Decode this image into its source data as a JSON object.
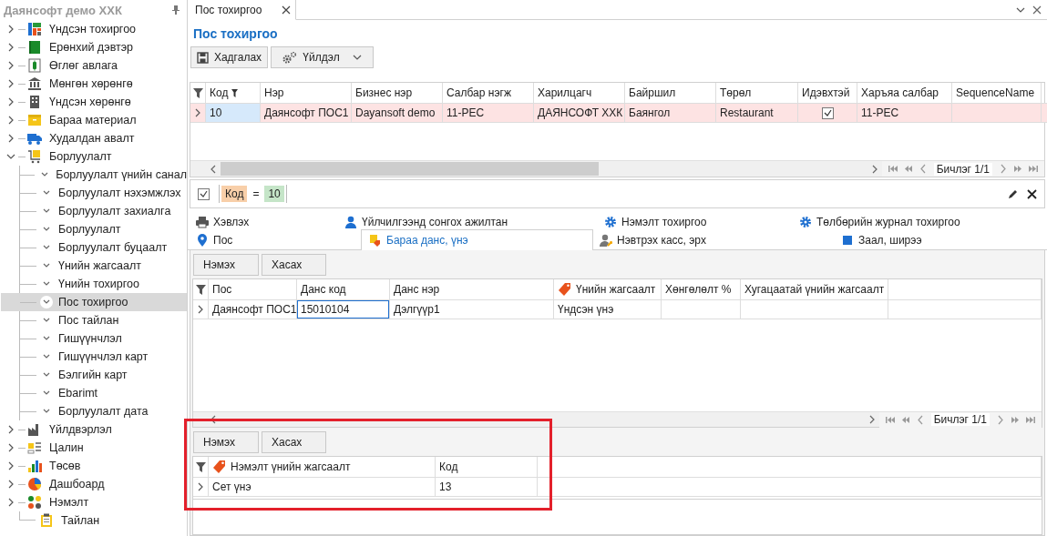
{
  "sidebar": {
    "title": "Даянсофт демо ХХК",
    "items": [
      {
        "label": "Үндсэн тохиргоо",
        "expanded": false
      },
      {
        "label": "Ерөнхий дэвтэр",
        "expanded": false
      },
      {
        "label": "Өглөг авлага",
        "expanded": false
      },
      {
        "label": "Мөнгөн хөрөнгө",
        "expanded": false
      },
      {
        "label": "Үндсэн хөрөнгө",
        "expanded": false
      },
      {
        "label": "Бараа материал",
        "expanded": false
      },
      {
        "label": "Худалдан авалт",
        "expanded": false
      },
      {
        "label": "Борлуулалт",
        "expanded": true,
        "children": [
          {
            "label": "Борлуулалт үнийн санал",
            "selected": false
          },
          {
            "label": "Борлуулалт нэхэмжлэх",
            "selected": false
          },
          {
            "label": "Борлуулалт захиалга",
            "selected": false
          },
          {
            "label": "Борлуулалт",
            "selected": false
          },
          {
            "label": "Борлуулалт буцаалт",
            "selected": false
          },
          {
            "label": "Үнийн жагсаалт",
            "selected": false
          },
          {
            "label": "Үнийн тохиргоо",
            "selected": false
          },
          {
            "label": "Пос тохиргоо",
            "selected": true
          },
          {
            "label": "Пос тайлан",
            "selected": false
          },
          {
            "label": "Гишүүнчлэл",
            "selected": false
          },
          {
            "label": "Гишүүнчлэл карт",
            "selected": false
          },
          {
            "label": "Бэлгийн карт",
            "selected": false
          },
          {
            "label": "Ebarimt",
            "selected": false
          },
          {
            "label": "Борлуулалт дата",
            "selected": false
          }
        ]
      },
      {
        "label": "Үйлдвэрлэл",
        "expanded": false
      },
      {
        "label": "Цалин",
        "expanded": false
      },
      {
        "label": "Төсөв",
        "expanded": false
      },
      {
        "label": "Дашбоард",
        "expanded": false
      },
      {
        "label": "Нэмэлт",
        "expanded": false
      },
      {
        "label": "Тайлан"
      }
    ]
  },
  "document_tab": {
    "label": "Пос тохиргоо"
  },
  "page_title": "Пос тохиргоо",
  "toolbar": [
    {
      "label": "Хадгалах",
      "kind": "save"
    },
    {
      "label": "Үйлдэл",
      "kind": "menu"
    }
  ],
  "main_grid": {
    "columns": [
      {
        "label": "Код",
        "filtered": true
      },
      {
        "label": "Нэр",
        "filtered": false
      },
      {
        "label": "Бизнес нэр",
        "filtered": false
      },
      {
        "label": "Салбар нэгж",
        "filtered": false
      },
      {
        "label": "Харилцагч",
        "filtered": false
      },
      {
        "label": "Байршил",
        "filtered": false
      },
      {
        "label": "Төрөл",
        "filtered": false
      },
      {
        "label": "Идэвхтэй",
        "filtered": false
      },
      {
        "label": "Харъяа салбар",
        "filtered": false
      },
      {
        "label": "SequenceName",
        "filtered": false
      }
    ],
    "rows": [
      {
        "selected": true,
        "cells": [
          {
            "kind": "text",
            "text": "10",
            "focused": true
          },
          {
            "kind": "text",
            "text": "Даянсофт ПОС1",
            "focused": false
          },
          {
            "kind": "text",
            "text": "Dayansoft demo",
            "focused": false
          },
          {
            "kind": "text",
            "text": "11-РЕС",
            "focused": false
          },
          {
            "kind": "text",
            "text": "ДАЯНСОФТ ХХК",
            "focused": false
          },
          {
            "kind": "text",
            "text": "Баянгол",
            "focused": false
          },
          {
            "kind": "text",
            "text": "Restaurant",
            "focused": false
          },
          {
            "kind": "checkbox",
            "checked": true,
            "focused": false
          },
          {
            "kind": "text",
            "text": "11-РЕС",
            "focused": false
          }
        ]
      }
    ],
    "pager": "Бичлэг 1/1"
  },
  "filter_bar": {
    "enabled": true,
    "field": "Код",
    "operator": "=",
    "value": "10"
  },
  "tab_rows": [
    {
      "tabs": [
        {
          "label": "Хэвлэх",
          "selected": false
        },
        {
          "label": "Үйлчилгээнд сонгох ажилтан",
          "selected": false
        },
        {
          "label": "Нэмэлт тохиргоо",
          "selected": false
        },
        {
          "label": "Төлбөрийн журнал тохиргоо",
          "selected": false
        }
      ]
    },
    {
      "tabs": [
        {
          "label": "Пос",
          "selected": false
        },
        {
          "label": "Бараа данс, үнэ",
          "selected": true
        },
        {
          "label": "Нэвтрэх касс, эрх",
          "selected": false
        },
        {
          "label": "Заал, ширээ",
          "selected": false
        }
      ]
    }
  ],
  "accounts_panel": {
    "buttons": [
      "Нэмэх",
      "Хасах"
    ],
    "grid": {
      "columns": [
        {
          "label": "Пос",
          "kind": "text"
        },
        {
          "label": "Данс код",
          "kind": "text"
        },
        {
          "label": "Данс нэр",
          "kind": "text"
        },
        {
          "label": "Үнийн жагсаалт",
          "kind": "lookup"
        },
        {
          "label": "Хөнгөлөлт %",
          "kind": "text"
        },
        {
          "label": "Хугацаатай үнийн жагсаалт",
          "kind": "text"
        }
      ],
      "rows": [
        {
          "selected": false,
          "cells": [
            {
              "kind": "text",
              "text": "Даянсофт ПОС1",
              "focused": false
            },
            {
              "kind": "text",
              "text": "15010104",
              "focused": true
            },
            {
              "kind": "text",
              "text": "Дэлгүүр1",
              "focused": false
            },
            {
              "kind": "text",
              "text": "Үндсэн үнэ",
              "focused": false
            }
          ]
        }
      ]
    },
    "pager": "Бичлэг 1/1"
  },
  "extra_price_panel": {
    "buttons": [
      "Нэмэх",
      "Хасах"
    ],
    "grid": {
      "columns": [
        {
          "label": "Нэмэлт үнийн жагсаалт",
          "kind": "lookup"
        },
        {
          "label": "Код",
          "kind": "text"
        }
      ],
      "rows": [
        {
          "selected": false,
          "cells": [
            {
              "kind": "text",
              "text": "Сет үнэ",
              "focused": false
            },
            {
              "kind": "text",
              "text": "13",
              "focused": false
            }
          ]
        }
      ]
    }
  }
}
